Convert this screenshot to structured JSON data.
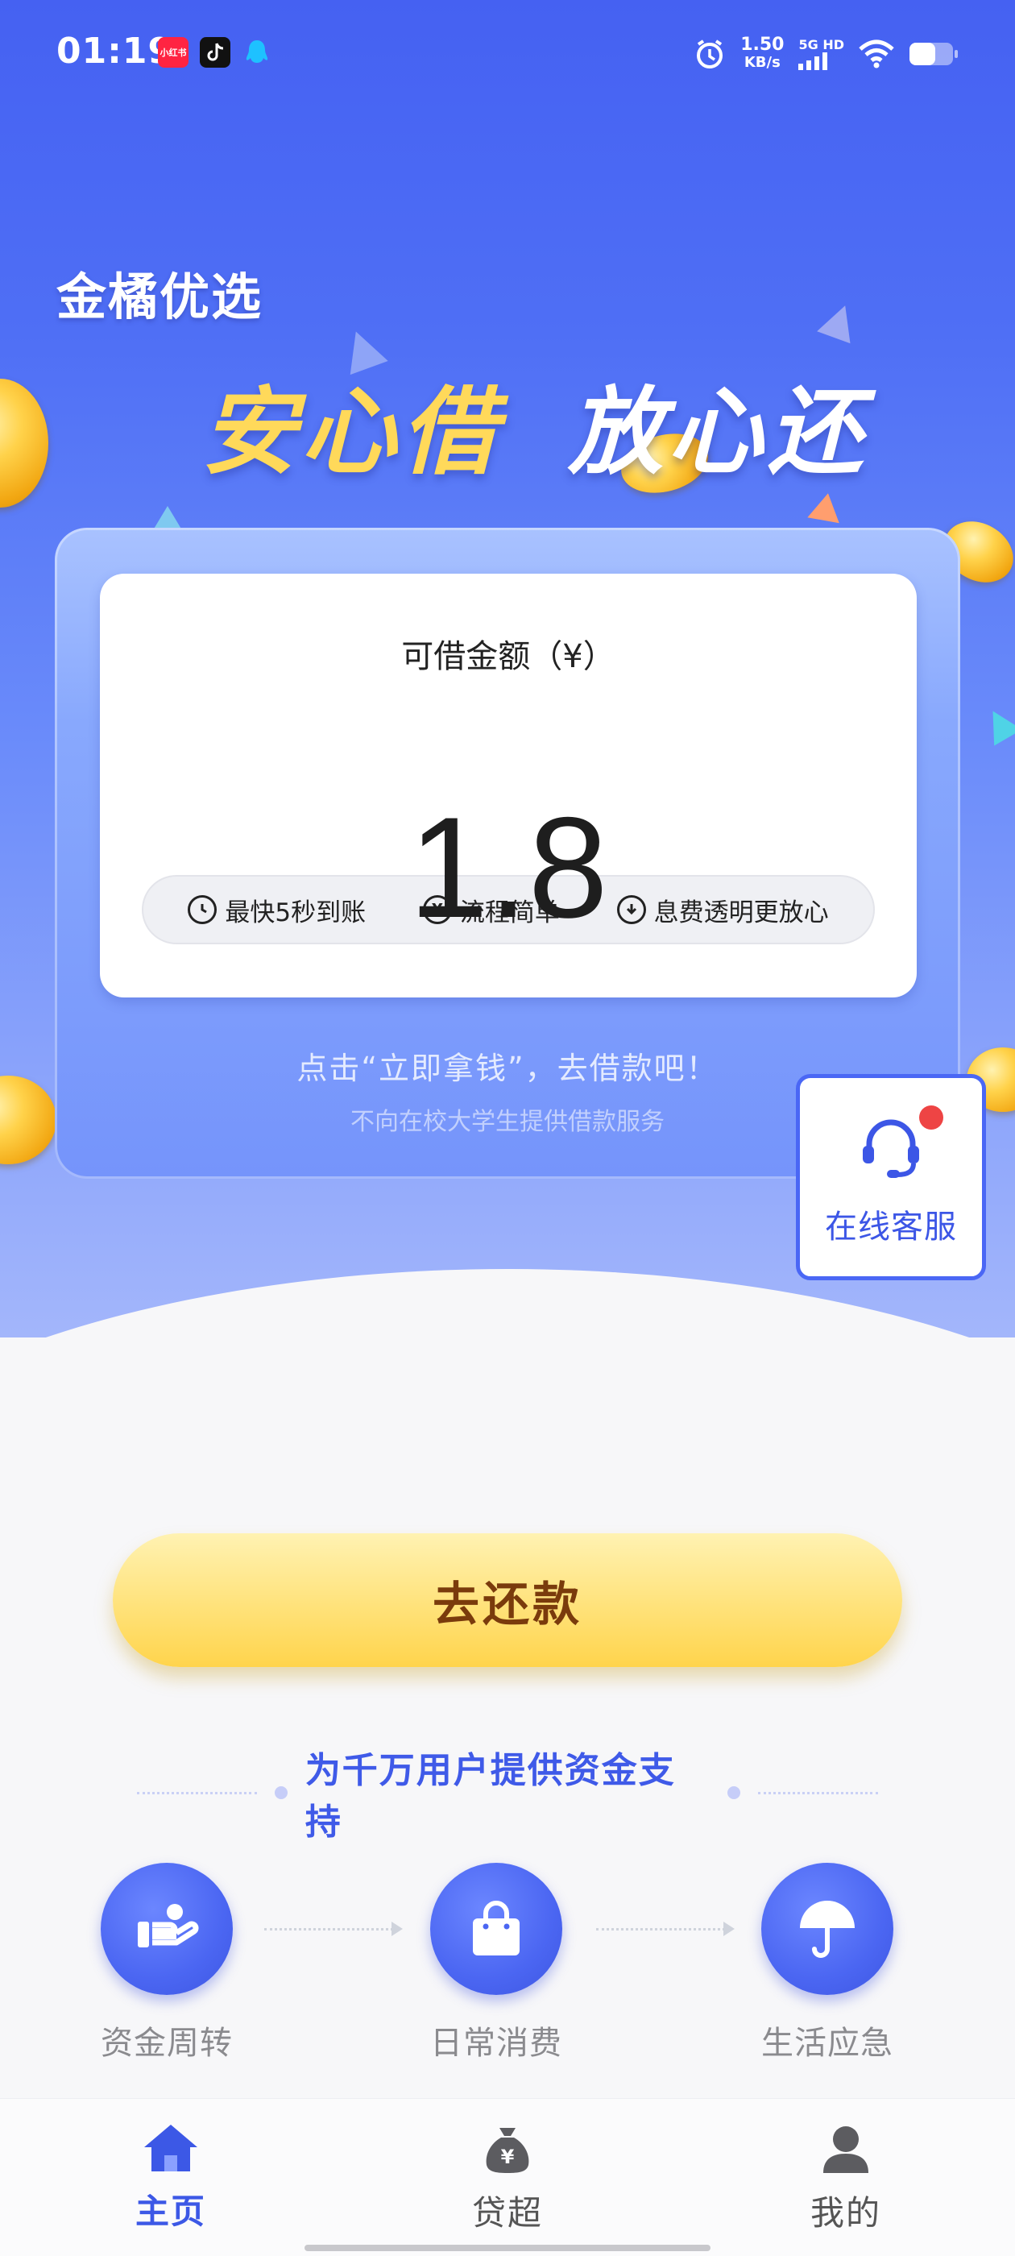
{
  "status_bar": {
    "time": "01:19",
    "apps": [
      "小红书",
      "tiktok-icon",
      "qq-icon"
    ],
    "net_speed_value": "1.50",
    "net_speed_unit": "KB/s",
    "network": "5G HD"
  },
  "hero": {
    "brand": "金橘优选",
    "slogan_part1": "安心借",
    "slogan_part2": "放心还"
  },
  "loan_card": {
    "label": "可借金额（¥）",
    "amount": "1.8",
    "features": [
      {
        "icon": "clock-icon",
        "text": "最快5秒到账"
      },
      {
        "icon": "yen-icon",
        "text": "流程简单"
      },
      {
        "icon": "download-icon",
        "text": "息费透明更放心"
      }
    ],
    "hint": "点击“立即拿钱”，去借款吧！",
    "disclaimer": "不向在校大学生提供借款服务"
  },
  "customer_service": {
    "label": "在线客服",
    "icon": "headset-icon"
  },
  "repay_button": {
    "label": "去还款"
  },
  "tagline": "为千万用户提供资金支持",
  "services": [
    {
      "icon": "hand-coin-icon",
      "label": "资金周转"
    },
    {
      "icon": "shopping-bag-icon",
      "label": "日常消费"
    },
    {
      "icon": "umbrella-icon",
      "label": "生活应急"
    }
  ],
  "tab_bar": {
    "items": [
      {
        "icon": "home-icon",
        "label": "主页",
        "active": true
      },
      {
        "icon": "money-bag-icon",
        "label": "贷超",
        "active": false
      },
      {
        "icon": "user-icon",
        "label": "我的",
        "active": false
      }
    ]
  },
  "colors": {
    "primary": "#4561f2",
    "accent_yellow": "#ffd44c",
    "repay_text": "#7a3b0c",
    "notification_red": "#ee4444"
  }
}
